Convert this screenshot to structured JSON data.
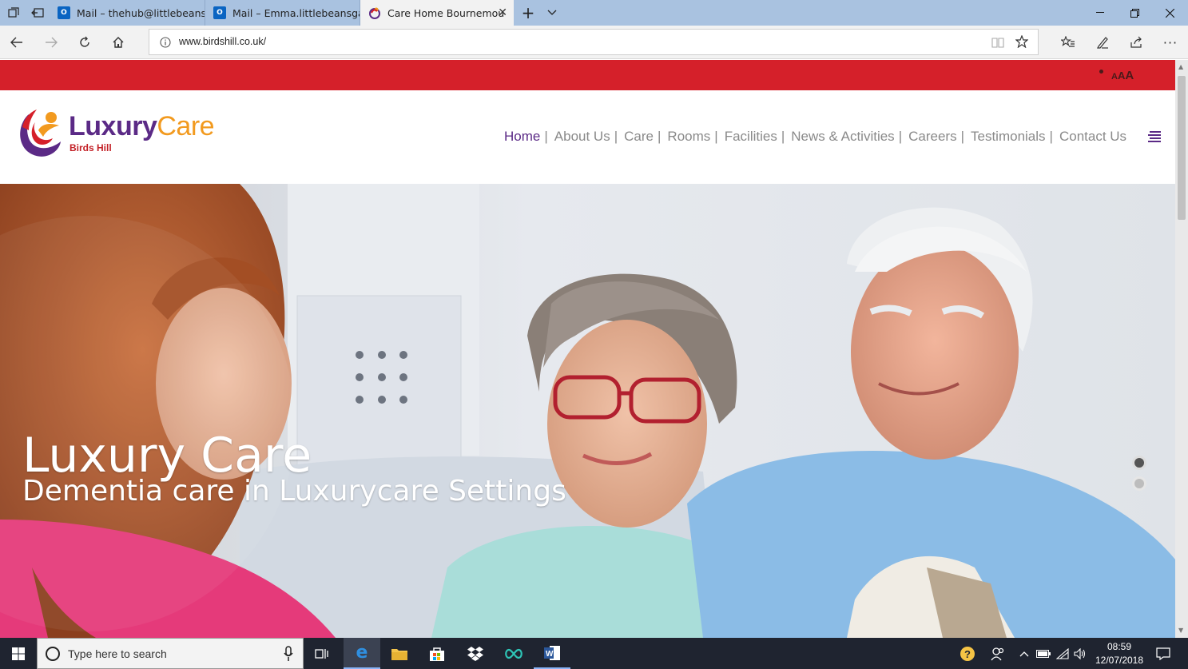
{
  "browser": {
    "tabs": [
      {
        "label": "Mail – thehub@littlebeansd",
        "icon": "outlook-icon"
      },
      {
        "label": "Mail – Emma.littlebeansgarl",
        "icon": "outlook-icon"
      },
      {
        "label": "Care Home Bournemou",
        "icon": "luxurycare-favicon"
      }
    ],
    "address": "www.birdshill.co.uk/"
  },
  "site": {
    "font_size_controls": "AAA",
    "logo": {
      "name_part1": "Luxury",
      "name_part2": "Care",
      "location": "Birds Hill"
    },
    "menu": [
      "Home",
      "About Us",
      "Care",
      "Rooms",
      "Facilities",
      "News & Activities",
      "Careers",
      "Testimonials",
      "Contact Us"
    ],
    "active_menu": "Home",
    "hero": {
      "title": "Luxury Care",
      "subtitle": "Dementia care in Luxurycare Settings",
      "slide_count": 2,
      "active_slide": 1
    },
    "colors": {
      "topbar": "#d5202a",
      "brand_purple": "#5b2a86",
      "brand_orange": "#f29a1f",
      "menu_text": "#8a8a8a"
    }
  },
  "taskbar": {
    "search_placeholder": "Type here to search",
    "time": "08:59",
    "date": "12/07/2018"
  }
}
